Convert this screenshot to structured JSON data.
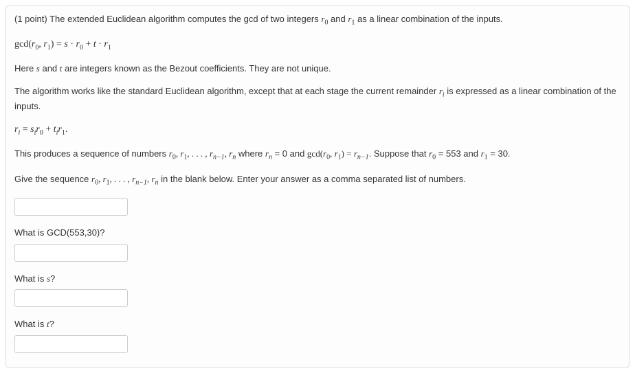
{
  "points": "(1 point) ",
  "intro": "The extended Euclidean algorithm computes the gcd of two integers ",
  "intro2": " and ",
  "intro3": " as a linear combination of the inputs.",
  "eq1_lhs": "gcd(",
  "eq1_mid": ", ",
  "eq1_rhs": ") = ",
  "eq1_s": "s",
  "eq1_dot": " · ",
  "eq1_t": "t",
  "here_s_t": "Here ",
  "here_s_t2": " and ",
  "here_s_t3": " are integers known as the Bezout coefficients. They are not unique.",
  "algo_text": "The algorithm works like the standard Euclidean algorithm, except that at each stage the current remainder ",
  "algo_text2": " is expressed as a linear combination of the inputs.",
  "eq2_eq": " = ",
  "eq2_plus": " + ",
  "eq2_dot": ".",
  "seq_text1": "This produces a sequence of numbers ",
  "seq_text2": " where ",
  "seq_text3": " = 0 and ",
  "seq_text4": ". Suppose that ",
  "seq_text5": " = 553 and ",
  "seq_text6": " = 30.",
  "gcd_eq": " = ",
  "give_text1": "Give the sequence ",
  "give_text2": " in the blank below. Enter your answer as a comma separated list of numbers.",
  "q_gcd": "What is GCD(553,30)?",
  "q_s1": "What is ",
  "q_s2": "?",
  "q_t1": "What is ",
  "q_t2": "?",
  "r": "r",
  "s": "s",
  "t": "t",
  "sub0": "0",
  "sub1": "1",
  "subi": "i",
  "subn": "n",
  "subn1": "n−1",
  "comma": ", ",
  "dots": ", . . . , ",
  "gcd": "gcd("
}
